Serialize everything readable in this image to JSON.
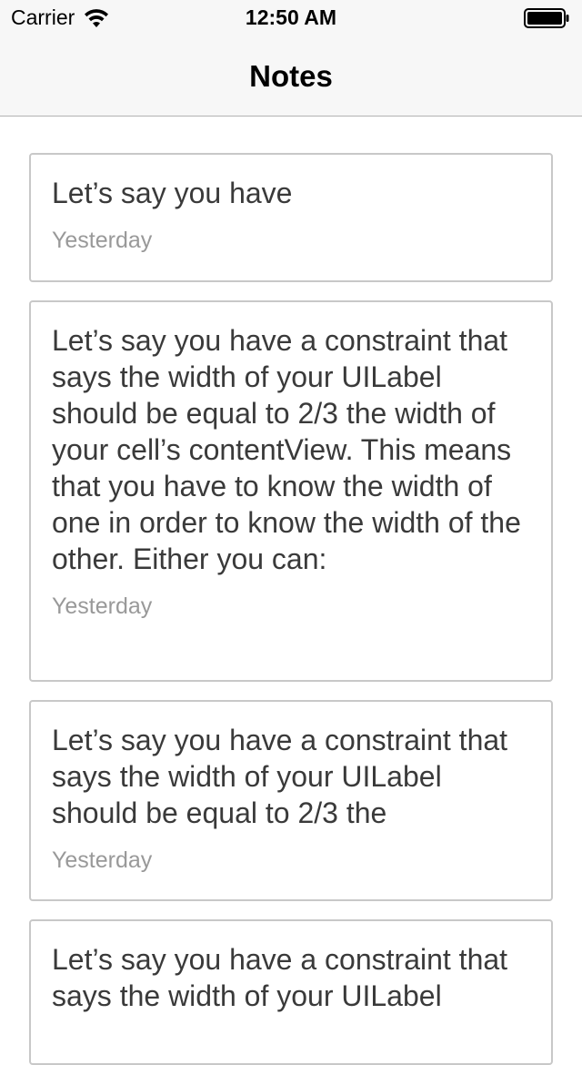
{
  "status_bar": {
    "carrier": "Carrier",
    "time": "12:50 AM",
    "icons": [
      "wifi-icon",
      "battery-icon"
    ]
  },
  "nav": {
    "title": "Notes"
  },
  "notes": [
    {
      "body": "Let’s say you have",
      "date": "Yesterday"
    },
    {
      "body": "Let’s say you have a constraint that says the width of your UILabel should be equal to 2/3 the width of your cell’s contentView. This means that you have to know the width of one in order to know the width of the other. Either you can:",
      "date": "Yesterday"
    },
    {
      "body": "Let’s say you have a constraint that says the width of your UILabel should be equal to 2/3 the",
      "date": "Yesterday"
    },
    {
      "body": "Let’s say you have a constraint that says the width of your UILabel",
      "date": ""
    }
  ],
  "colors": {
    "bar_background": "#f7f7f7",
    "card_border": "#c8c8c8",
    "body_text": "#3a3a3a",
    "date_text": "#999999"
  }
}
